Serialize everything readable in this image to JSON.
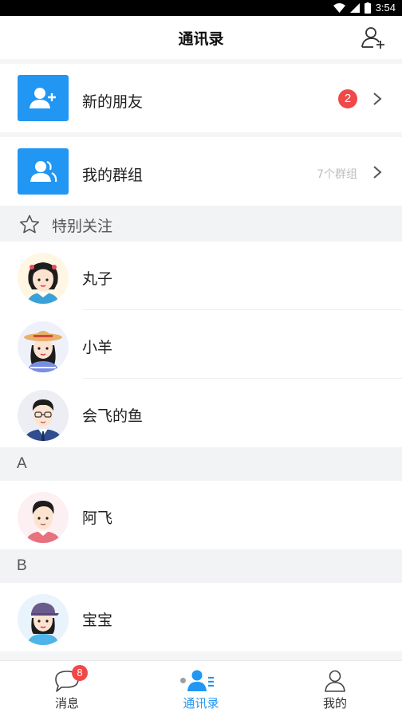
{
  "status_bar": {
    "time": "3:54"
  },
  "header": {
    "title": "通讯录"
  },
  "rows": {
    "new_friends": {
      "label": "新的朋友",
      "badge": "2"
    },
    "my_groups": {
      "label": "我的群组",
      "count": "7个群组"
    }
  },
  "sections": {
    "special": {
      "title": "特别关注"
    },
    "a": {
      "letter": "A"
    },
    "b": {
      "letter": "B"
    }
  },
  "contacts": {
    "special": [
      {
        "name": "丸子"
      },
      {
        "name": "小羊"
      },
      {
        "name": "会飞的鱼"
      }
    ],
    "a": [
      {
        "name": "阿飞"
      }
    ],
    "b": [
      {
        "name": "宝宝"
      }
    ]
  },
  "tabbar": {
    "messages": {
      "label": "消息",
      "badge": "8"
    },
    "contacts": {
      "label": "通讯录"
    },
    "me": {
      "label": "我的"
    }
  },
  "colors": {
    "accent": "#2196f3",
    "badge": "#f04848"
  }
}
